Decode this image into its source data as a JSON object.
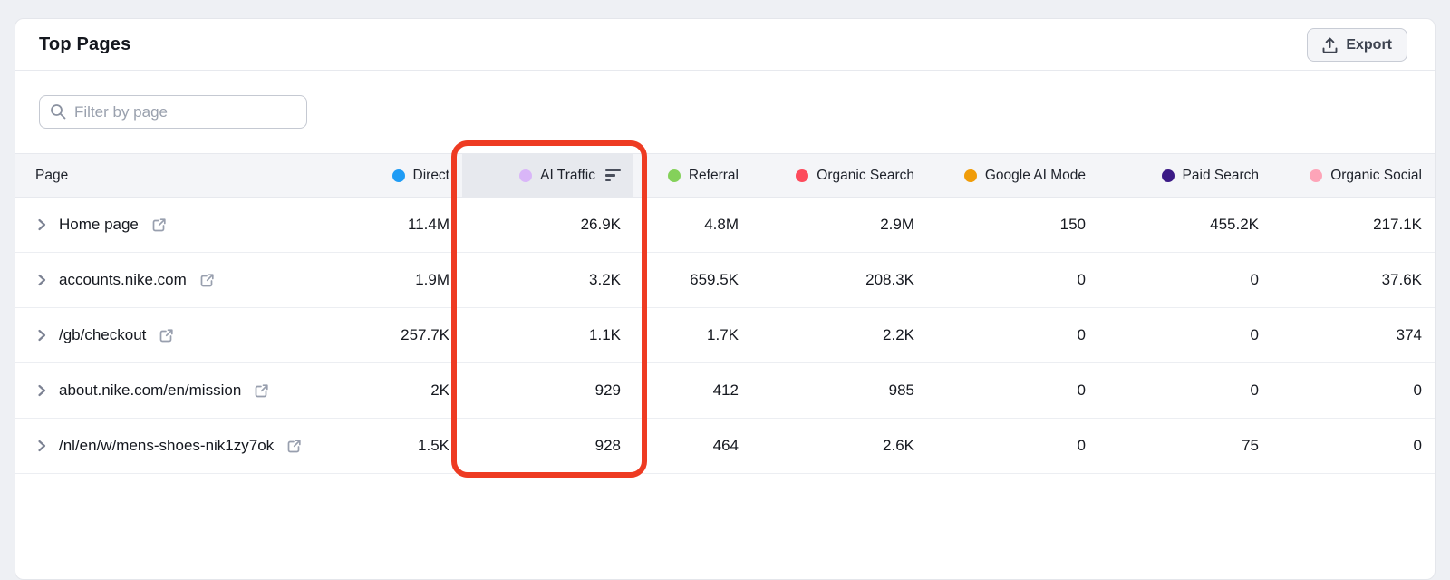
{
  "card": {
    "title": "Top Pages",
    "export_label": "Export"
  },
  "filter": {
    "placeholder": "Filter by page"
  },
  "annotation": {
    "color": "#ee3b22",
    "highlighted_column": "AI Traffic"
  },
  "table": {
    "page_header": "Page",
    "columns": [
      {
        "label": "Direct",
        "color": "#1f9cf5"
      },
      {
        "label": "AI Traffic",
        "color": "#d9b6f8",
        "sorted": "desc"
      },
      {
        "label": "Referral",
        "color": "#84d15a"
      },
      {
        "label": "Organic Search",
        "color": "#fd4b5c"
      },
      {
        "label": "Google AI Mode",
        "color": "#f09c09"
      },
      {
        "label": "Paid Search",
        "color": "#3b1a86"
      },
      {
        "label": "Organic Social",
        "color": "#fda4b8"
      }
    ],
    "rows": [
      {
        "page": "Home page",
        "values": [
          "11.4M",
          "26.9K",
          "4.8M",
          "2.9M",
          "150",
          "455.2K",
          "217.1K"
        ]
      },
      {
        "page": "accounts.nike.com",
        "values": [
          "1.9M",
          "3.2K",
          "659.5K",
          "208.3K",
          "0",
          "0",
          "37.6K"
        ]
      },
      {
        "page": "/gb/checkout",
        "values": [
          "257.7K",
          "1.1K",
          "1.7K",
          "2.2K",
          "0",
          "0",
          "374"
        ]
      },
      {
        "page": "about.nike.com/en/mission",
        "values": [
          "2K",
          "929",
          "412",
          "985",
          "0",
          "0",
          "0"
        ]
      },
      {
        "page": "/nl/en/w/mens-shoes-nik1zy7ok",
        "values": [
          "1.5K",
          "928",
          "464",
          "2.6K",
          "0",
          "75",
          "0"
        ]
      }
    ]
  }
}
